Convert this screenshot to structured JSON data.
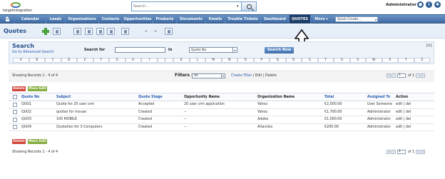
{
  "brand": {
    "name": "targetintegration"
  },
  "search": {
    "placeholder": "Search..."
  },
  "user": {
    "name": "Administrator"
  },
  "nav": {
    "items": [
      "Calendar",
      "Leads",
      "Organisations",
      "Contacts",
      "Opportunities",
      "Products",
      "Documents",
      "Emails",
      "Trouble Tickets",
      "Dashboard",
      "QUOTES",
      "More"
    ],
    "more_label": "More ▾",
    "quick_create": "Quick Create..."
  },
  "page": {
    "title": "Quotes"
  },
  "search_panel": {
    "title": "Search",
    "advanced_link": "Go to Advanced Search",
    "search_for_label": "Search for",
    "in_label": "In",
    "in_value": "Quote No",
    "search_button": "Search Now",
    "close_label": "[x]",
    "alphabet": [
      "A",
      "B",
      "C",
      "D",
      "E",
      "F",
      "G",
      "H",
      "I",
      "J",
      "K",
      "L",
      "M",
      "N",
      "O",
      "P",
      "Q",
      "R",
      "S",
      "T",
      "U",
      "V",
      "W",
      "X",
      "Y",
      "Z"
    ]
  },
  "list": {
    "showing": "Showing Records 1 - 4 of 4",
    "filters_label": "Filters :",
    "filter_value": "All",
    "create_filter": "Create Filter",
    "edit_label": "Edit",
    "delete_label": "Delete",
    "sep": "|",
    "page_value": "1",
    "page_of": "of 1",
    "delete_button": "Delete",
    "mass_edit_button": "Mass Edit",
    "columns": [
      "Quote No",
      "Subject",
      "Quote Stage",
      "Opportunity Name",
      "Organization Name",
      "Total",
      "Assigned To",
      "Action"
    ],
    "rows": [
      {
        "no": "QUO1",
        "subject": "Quote for 20 user crm",
        "stage": "Accepted",
        "opp": "20 user crm application",
        "org": "Yahoo",
        "total": "€2,500.00",
        "assigned": "User Someone",
        "action": "edit | del"
      },
      {
        "no": "QUO2",
        "subject": "quotes for mouse",
        "stage": "Created",
        "opp": "--",
        "org": "Yahoo",
        "total": "€1,700.00",
        "assigned": "Administrator",
        "action": "edit | del"
      },
      {
        "no": "QUO3",
        "subject": "100 MOBILE",
        "stage": "Created",
        "opp": "--",
        "org": "Adobe",
        "total": "€1,000.00",
        "assigned": "Administrator",
        "action": "edit | del"
      },
      {
        "no": "QUO4",
        "subject": "Quotation for 3 Computers",
        "stage": "Created",
        "opp": "--",
        "org": "Altavista",
        "total": "€200.00",
        "assigned": "Administrator",
        "action": "edit | del"
      }
    ]
  },
  "colors": {
    "nav_top": "#6c95c6",
    "nav_bottom": "#3e6aa3",
    "active": "#1f3e69",
    "link": "#2a5db0",
    "delete": "#d2453b",
    "mass_edit": "#85ad3e"
  }
}
